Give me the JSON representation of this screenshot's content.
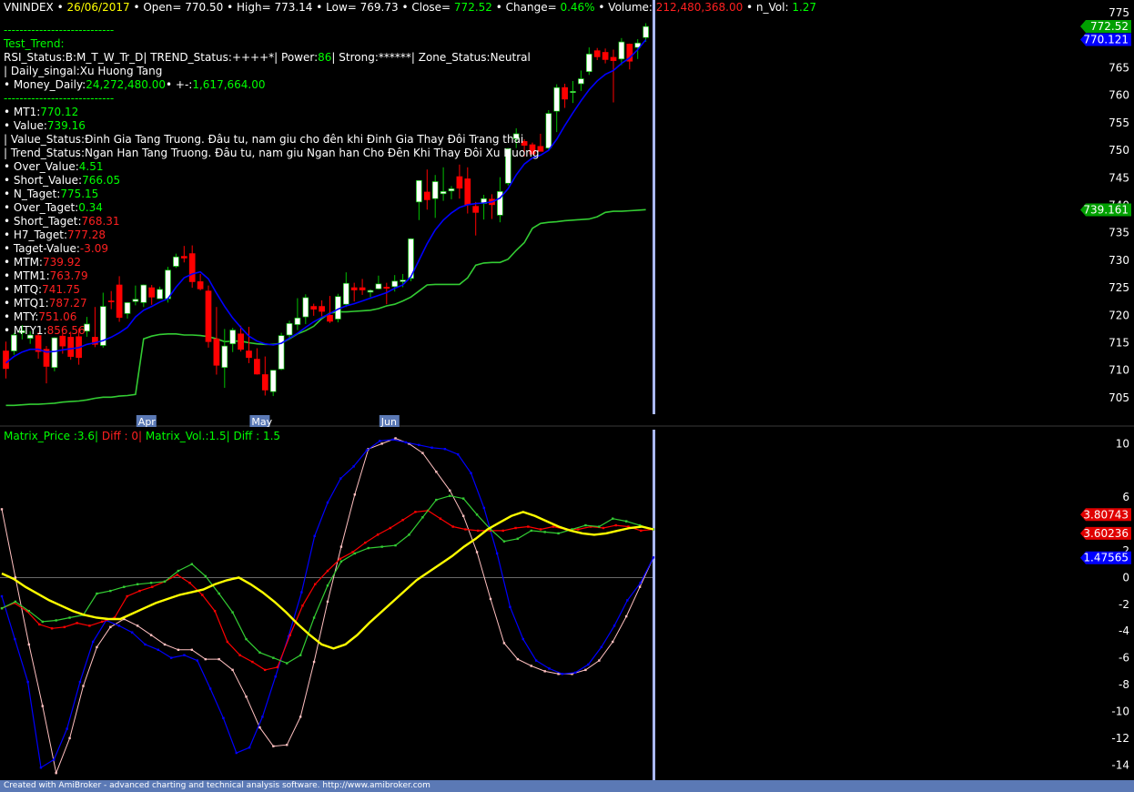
{
  "header": {
    "symbol": "VNINDEX",
    "date": "26/06/2017",
    "open": "770.50",
    "high": "773.14",
    "low": "769.73",
    "close": "772.52",
    "change": "0.46%",
    "volume": "212,480,368.00",
    "n_vol": "1.27"
  },
  "info": {
    "separator": "----------------------------",
    "test_trend": "Test_Trend:",
    "rsi_line_a": "RSI_Status:B:M_T_W_Tr_D| TREND_Status:++++*| Power:",
    "power": "86",
    "rsi_line_b": "| Strong:******| Zone_Status:Neutral",
    "daily_signal": "| Daily_singal:Xu Huong Tang",
    "money_label": "• Money_Daily:",
    "money_value": "24,272,480.00",
    "money_change_label": "• +-:",
    "money_change": "1,617,664.00",
    "value_status": "| Value_Status:Đinh Gia Tang Truong. Đâu tu, nam giu cho đên khi Đinh Gia Thay Đôi Trang thai",
    "trend_status": "| Trend_Status:Ngan Han Tang Truong. Đâu tu, nam giu Ngan han Cho Đên Khi Thay Đôi Xu Huong",
    "metrics": [
      {
        "label": "• MT1:",
        "value": "770.12",
        "color": "#00ff00"
      },
      {
        "label": "• Value:",
        "value": "739.16",
        "color": "#00ff00"
      },
      {
        "label": "• Over_Value:",
        "value": "4.51",
        "color": "#00ff00"
      },
      {
        "label": "• Short_Value:",
        "value": "766.05",
        "color": "#00ff00"
      },
      {
        "label": "• N_Taget:",
        "value": "775.15",
        "color": "#00ff00"
      },
      {
        "label": "• Over_Taget:",
        "value": "0.34",
        "color": "#00ff00"
      },
      {
        "label": "• Short_Taget:",
        "value": "768.31",
        "color": "#ff2020"
      },
      {
        "label": "• H7_Taget:",
        "value": "777.28",
        "color": "#ff2020"
      },
      {
        "label": "• Taget-Value:",
        "value": "-3.09",
        "color": "#ff2020"
      },
      {
        "label": "• MTM:",
        "value": "739.92",
        "color": "#ff2020"
      },
      {
        "label": "• MTM1:",
        "value": "763.79",
        "color": "#ff2020"
      },
      {
        "label": "• MTQ:",
        "value": "741.75",
        "color": "#ff2020"
      },
      {
        "label": "• MTQ1:",
        "value": "787.27",
        "color": "#ff2020"
      },
      {
        "label": "• MTY:",
        "value": "751.06",
        "color": "#ff2020"
      },
      {
        "label": "• MTY1:",
        "value": "856.56",
        "color": "#ff2020"
      }
    ]
  },
  "indicator_header": {
    "matrix_price": "Matrix_Price :3.6|",
    "diff1": "Diff : 0|",
    "matrix_vol": "Matrix_Vol.:1.5|",
    "diff2": "Diff : 1.5"
  },
  "footer": "Created with AmiBroker - advanced charting and technical analysis software. http://www.amibroker.com",
  "colors": {
    "up_candle": "#ffffff",
    "down_candle": "#ff0000",
    "ma_short": "#0000ff",
    "ma_long": "#33cc33",
    "matrix_price": "#ffff00",
    "matrix_red": "#ff0000",
    "green_line": "#33cc33",
    "pink_line": "#ffc0c0",
    "blue_line": "#0000ff",
    "axis_text": "#ffffff",
    "cursor": "#aab8ff"
  },
  "chart_data": [
    {
      "type": "candlestick",
      "title": "VNINDEX",
      "ylim": [
        702,
        776
      ],
      "yticks": [
        705,
        710,
        715,
        720,
        725,
        730,
        735,
        740,
        745,
        750,
        755,
        760,
        765,
        770,
        775
      ],
      "month_labels": [
        {
          "label": "Apr",
          "bar": 17
        },
        {
          "label": "May",
          "bar": 31
        },
        {
          "label": "Jun",
          "bar": 47
        }
      ],
      "last_labels": [
        {
          "value": "772.52",
          "series": "close"
        },
        {
          "value": "770.121",
          "series": "MT1"
        },
        {
          "value": "739.161",
          "series": "Value"
        }
      ],
      "ohlc": [
        [
          713.5,
          715.2,
          708.5,
          710.3
        ],
        [
          713.5,
          716.8,
          712.8,
          716.4
        ],
        [
          716.8,
          718.2,
          715.6,
          717.2
        ],
        [
          715.8,
          717.1,
          714.8,
          716.4
        ],
        [
          716.3,
          716.9,
          712.1,
          713.4
        ],
        [
          713.8,
          714.4,
          707.6,
          710.7
        ],
        [
          710.5,
          716.0,
          709.8,
          715.9
        ],
        [
          716.2,
          716.7,
          713.0,
          714.4
        ],
        [
          716.0,
          717.0,
          711.9,
          712.5
        ],
        [
          716.1,
          717.6,
          711.0,
          712.3
        ],
        [
          717.1,
          719.7,
          716.1,
          718.4
        ],
        [
          716.0,
          721.5,
          714.2,
          714.7
        ],
        [
          714.5,
          724.1,
          714.1,
          721.6
        ],
        [
          722.6,
          724.4,
          721.1,
          722.5
        ],
        [
          725.5,
          727.1,
          718.8,
          719.6
        ],
        [
          720.3,
          722.4,
          719.4,
          722.3
        ],
        [
          722.5,
          725.4,
          721.8,
          722.9
        ],
        [
          722.3,
          725.6,
          721.5,
          725.5
        ],
        [
          725.0,
          725.5,
          721.9,
          723.3
        ],
        [
          723.0,
          725.2,
          723.0,
          724.7
        ],
        [
          723.0,
          728.8,
          722.3,
          728.2
        ],
        [
          728.9,
          731.2,
          728.6,
          730.6
        ],
        [
          730.7,
          732.6,
          729.6,
          730.4
        ],
        [
          731.2,
          732.7,
          725.0,
          726.1
        ],
        [
          726.1,
          727.5,
          724.5,
          724.8
        ],
        [
          724.4,
          725.4,
          714.1,
          715.2
        ],
        [
          715.7,
          721.5,
          709.2,
          710.9
        ],
        [
          710.5,
          717.5,
          706.8,
          714.4
        ],
        [
          714.8,
          717.7,
          713.3,
          717.3
        ],
        [
          716.6,
          718.1,
          713.4,
          713.8
        ],
        [
          713.5,
          717.9,
          711.3,
          712.3
        ],
        [
          712.0,
          714.0,
          709.2,
          709.3
        ],
        [
          709.2,
          712.5,
          705.4,
          706.4
        ],
        [
          706.1,
          710.0,
          705.3,
          710.0
        ],
        [
          710.2,
          716.8,
          710.0,
          716.3
        ],
        [
          716.4,
          719.0,
          715.8,
          718.5
        ],
        [
          718.3,
          723.1,
          717.3,
          719.5
        ],
        [
          719.7,
          723.8,
          718.4,
          723.2
        ],
        [
          721.6,
          722.1,
          719.9,
          721.1
        ],
        [
          721.6,
          722.7,
          719.8,
          720.7
        ],
        [
          720.0,
          723.5,
          718.6,
          718.9
        ],
        [
          719.3,
          723.9,
          718.7,
          723.4
        ],
        [
          722.0,
          727.8,
          721.5,
          725.8
        ],
        [
          725.0,
          725.9,
          722.5,
          724.6
        ],
        [
          725.0,
          726.6,
          723.7,
          724.6
        ],
        [
          724.2,
          724.7,
          723.3,
          724.5
        ],
        [
          724.8,
          727.2,
          724.7,
          725.7
        ],
        [
          725.1,
          725.9,
          722.0,
          724.9
        ],
        [
          725.2,
          727.3,
          724.3,
          726.2
        ],
        [
          726.1,
          727.5,
          725.1,
          726.4
        ],
        [
          726.7,
          734.0,
          726.2,
          733.9
        ],
        [
          740.6,
          744.3,
          737.3,
          744.5
        ],
        [
          742.4,
          746.5,
          739.2,
          741.0
        ],
        [
          741.2,
          745.5,
          737.7,
          744.3
        ],
        [
          742.1,
          746.9,
          740.8,
          742.5
        ],
        [
          742.6,
          743.5,
          741.1,
          743.0
        ],
        [
          745.2,
          747.4,
          741.2,
          743.1
        ],
        [
          744.8,
          746.9,
          738.5,
          740.1
        ],
        [
          739.8,
          740.6,
          734.5,
          738.7
        ],
        [
          740.3,
          741.9,
          737.4,
          741.2
        ],
        [
          741.1,
          742.0,
          737.5,
          740.1
        ],
        [
          738.2,
          745.1,
          736.9,
          742.5
        ],
        [
          744.0,
          750.4,
          743.6,
          750.3
        ],
        [
          752.1,
          754.0,
          750.4,
          753.0
        ],
        [
          751.6,
          752.0,
          748.9,
          750.9
        ],
        [
          751.0,
          751.4,
          749.3,
          749.3
        ],
        [
          750.7,
          753.0,
          749.8,
          749.8
        ],
        [
          750.4,
          757.3,
          750.0,
          756.7
        ],
        [
          757.1,
          762.0,
          753.3,
          761.4
        ],
        [
          761.4,
          762.1,
          757.7,
          759.3
        ],
        [
          760.5,
          762.6,
          758.6,
          760.7
        ],
        [
          762.1,
          764.5,
          760.8,
          763.0
        ],
        [
          764.3,
          768.7,
          763.7,
          767.5
        ],
        [
          768.1,
          768.6,
          766.4,
          767.0
        ],
        [
          767.8,
          768.5,
          765.8,
          766.5
        ],
        [
          766.9,
          768.3,
          758.7,
          766.3
        ],
        [
          766.6,
          770.4,
          765.5,
          769.7
        ],
        [
          769.3,
          769.4,
          764.7,
          766.2
        ],
        [
          768.7,
          770.2,
          766.6,
          769.5
        ],
        [
          770.5,
          773.1,
          769.7,
          772.5
        ]
      ],
      "series": [
        {
          "name": "MT1",
          "values": [
            711.3,
            712.5,
            713.3,
            713.8,
            713.8,
            713.3,
            713.4,
            713.7,
            713.9,
            714.1,
            714.7,
            715.0,
            715.4,
            716.0,
            716.8,
            717.8,
            719.7,
            720.9,
            721.6,
            722.4,
            723.0,
            725.1,
            726.8,
            727.5,
            727.9,
            726.6,
            724.0,
            721.6,
            719.5,
            717.8,
            716.2,
            715.3,
            714.8,
            714.6,
            714.9,
            715.8,
            716.7,
            717.8,
            718.8,
            719.6,
            720.3,
            721.1,
            721.7,
            722.1,
            722.6,
            723.1,
            723.6,
            724.1,
            724.9,
            725.5,
            727.0,
            730.0,
            733.0,
            735.5,
            737.3,
            738.6,
            739.6,
            740.1,
            740.3,
            740.4,
            740.6,
            741.3,
            743.0,
            745.5,
            747.5,
            748.6,
            749.1,
            750.0,
            752.0,
            754.5,
            756.8,
            759.0,
            761.0,
            762.6,
            763.8,
            764.5,
            765.8,
            766.8,
            768.3,
            770.1
          ]
        },
        {
          "name": "Value",
          "values": [
            703.6,
            703.6,
            703.7,
            703.8,
            703.8,
            703.9,
            704.0,
            704.2,
            704.3,
            704.4,
            704.6,
            704.9,
            705.1,
            705.1,
            705.3,
            705.4,
            705.6,
            715.7,
            716.2,
            716.5,
            716.6,
            716.6,
            716.4,
            716.4,
            716.3,
            716.1,
            715.7,
            715.2,
            715.3,
            715.3,
            715.0,
            714.8,
            714.7,
            714.7,
            714.9,
            715.7,
            716.6,
            717.2,
            718.0,
            719.4,
            720.4,
            720.6,
            720.6,
            720.7,
            720.8,
            720.9,
            721.2,
            721.7,
            722.0,
            722.6,
            723.3,
            724.4,
            725.5,
            725.6,
            725.6,
            725.6,
            725.6,
            726.8,
            729.1,
            729.5,
            729.6,
            729.6,
            730.2,
            731.8,
            733.2,
            735.8,
            736.7,
            736.9,
            737.0,
            737.2,
            737.3,
            737.4,
            737.5,
            737.9,
            738.7,
            738.9,
            738.9,
            739.0,
            739.1,
            739.2
          ]
        }
      ]
    },
    {
      "type": "line",
      "title": "Matrix_Price / Matrix_Vol",
      "ylim": [
        -15,
        10.5
      ],
      "yticks": [
        -14,
        -12,
        -10,
        -8,
        -6,
        -4,
        -2,
        0,
        2,
        6,
        10
      ],
      "last_labels": [
        {
          "value": "3.80743",
          "series": "red"
        },
        {
          "value": "3.60236",
          "series": "red"
        },
        {
          "value": "1.47565",
          "series": "blue"
        }
      ],
      "series": [
        {
          "name": "yellow",
          "values": [
            0.3,
            -0.1,
            -0.7,
            -1.2,
            -1.7,
            -2.1,
            -2.5,
            -2.8,
            -3.0,
            -3.1,
            -3.1,
            -2.7,
            -2.3,
            -1.9,
            -1.6,
            -1.3,
            -1.1,
            -0.9,
            -0.5,
            -0.2,
            0.0,
            -0.5,
            -1.1,
            -1.8,
            -2.6,
            -3.5,
            -4.3,
            -5.0,
            -5.3,
            -5.0,
            -4.3,
            -3.4,
            -2.6,
            -1.8,
            -1.0,
            -0.2,
            0.4,
            1.0,
            1.6,
            2.3,
            2.9,
            3.6,
            4.1,
            4.6,
            4.9,
            4.6,
            4.2,
            3.8,
            3.5,
            3.3,
            3.2,
            3.3,
            3.5,
            3.7,
            3.8,
            3.6
          ]
        },
        {
          "name": "red",
          "values": [
            -2.3,
            -1.9,
            -2.5,
            -3.5,
            -3.8,
            -3.7,
            -3.4,
            -3.6,
            -3.3,
            -3.0,
            -1.4,
            -1.0,
            -0.7,
            -0.3,
            0.2,
            -0.4,
            -1.3,
            -2.5,
            -4.8,
            -5.8,
            -6.3,
            -6.9,
            -6.7,
            -4.3,
            -2.1,
            -0.5,
            0.5,
            1.4,
            1.9,
            2.6,
            3.2,
            3.7,
            4.3,
            4.9,
            5.0,
            4.4,
            3.8,
            3.6,
            3.5,
            3.5,
            3.5,
            3.7,
            3.8,
            3.6,
            3.8,
            3.6,
            3.6,
            3.8,
            3.7,
            3.9,
            3.8,
            3.5,
            3.6
          ]
        },
        {
          "name": "green",
          "values": [
            -2.3,
            -1.8,
            -2.5,
            -3.3,
            -3.2,
            -3.0,
            -2.8,
            -1.2,
            -1.0,
            -0.7,
            -0.5,
            -0.4,
            -0.3,
            0.5,
            1.0,
            0.1,
            -1.2,
            -2.6,
            -4.6,
            -5.6,
            -6.0,
            -6.4,
            -5.8,
            -3.0,
            -0.6,
            1.2,
            1.8,
            2.2,
            2.3,
            2.4,
            3.2,
            4.5,
            5.8,
            6.1,
            5.9,
            4.7,
            3.6,
            2.7,
            2.9,
            3.5,
            3.4,
            3.3,
            3.6,
            3.9,
            3.8,
            4.4,
            4.2,
            3.9,
            3.6
          ]
        },
        {
          "name": "pink",
          "values": [
            5.1,
            0.0,
            -5.0,
            -9.6,
            -14.6,
            -12.0,
            -8.1,
            -5.2,
            -3.7,
            -3.1,
            -3.6,
            -4.3,
            -5.0,
            -5.4,
            -5.4,
            -6.1,
            -6.1,
            -6.9,
            -8.9,
            -11.2,
            -12.6,
            -12.5,
            -10.4,
            -6.3,
            -1.8,
            2.3,
            6.2,
            9.6,
            10.0,
            10.4,
            10.0,
            9.3,
            7.9,
            6.5,
            4.6,
            1.9,
            -1.6,
            -4.9,
            -6.1,
            -6.6,
            -7.0,
            -7.2,
            -7.2,
            -6.9,
            -6.2,
            -4.8,
            -2.9,
            -0.7,
            1.5
          ]
        },
        {
          "name": "blue",
          "values": [
            -1.4,
            -4.6,
            -7.8,
            -14.2,
            -13.6,
            -11.3,
            -7.8,
            -4.8,
            -3.2,
            -3.6,
            -4.1,
            -5.0,
            -5.4,
            -6.0,
            -5.8,
            -6.2,
            -8.3,
            -10.5,
            -13.1,
            -12.7,
            -10.4,
            -7.4,
            -4.4,
            -1.1,
            3.1,
            5.6,
            7.4,
            8.3,
            9.5,
            10.2,
            10.3,
            10.1,
            9.9,
            9.7,
            9.6,
            9.2,
            7.8,
            5.2,
            1.8,
            -2.2,
            -4.6,
            -6.2,
            -6.8,
            -7.2,
            -7.1,
            -6.5,
            -5.2,
            -3.6,
            -1.7,
            -0.4,
            1.5
          ]
        }
      ]
    }
  ]
}
